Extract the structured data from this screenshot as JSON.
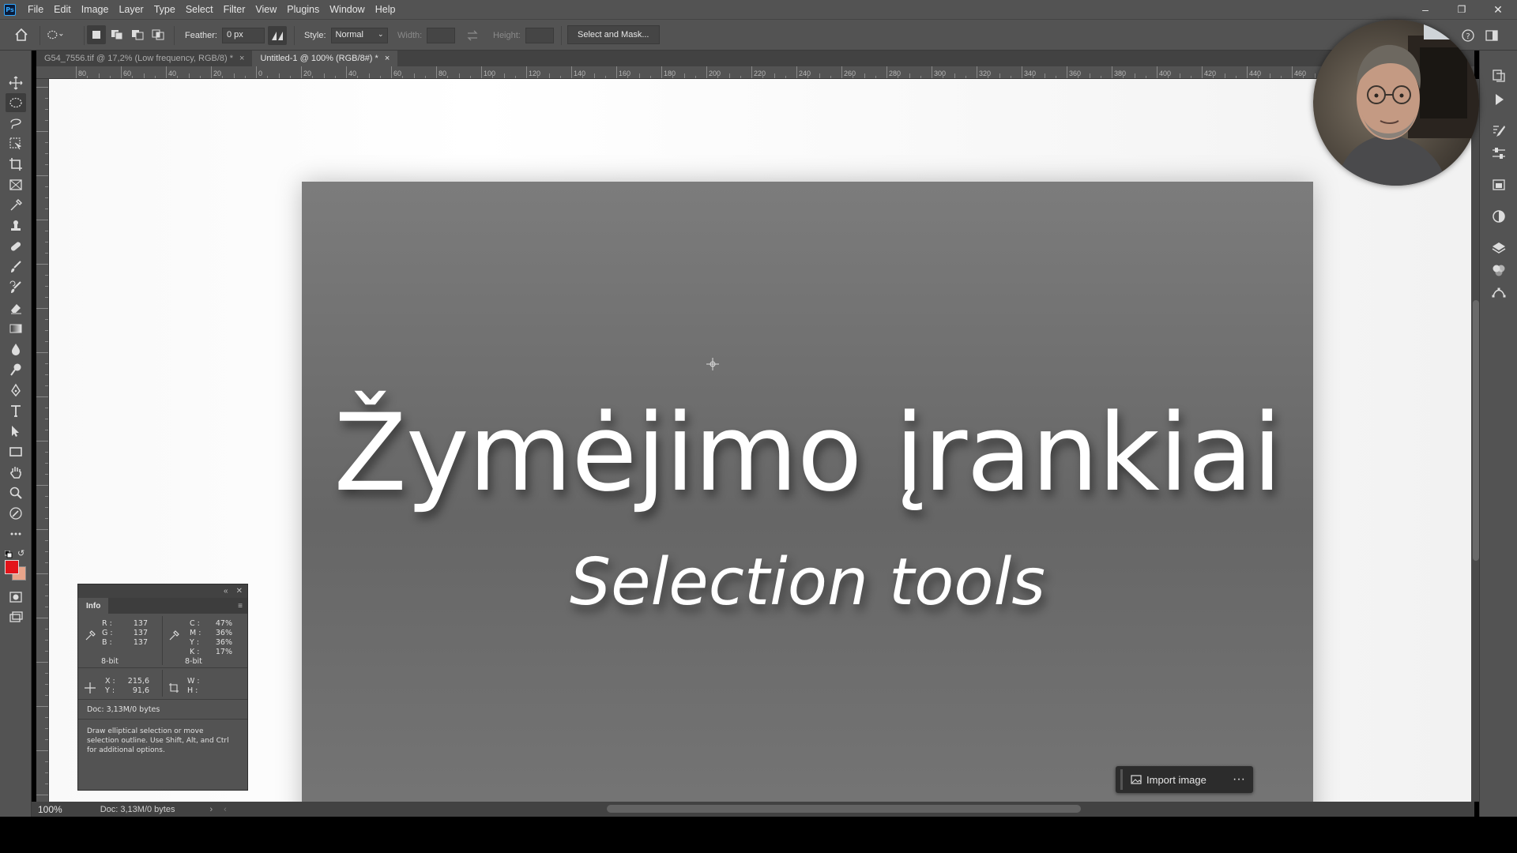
{
  "app": {
    "logo": "Ps"
  },
  "menu": [
    "File",
    "Edit",
    "Image",
    "Layer",
    "Type",
    "Select",
    "Filter",
    "View",
    "Plugins",
    "Window",
    "Help"
  ],
  "window_controls": {
    "minimize": "–",
    "restore": "❐",
    "close": "✕"
  },
  "options": {
    "feather_label": "Feather:",
    "feather_value": "0 px",
    "style_label": "Style:",
    "style_value": "Normal",
    "width_label": "Width:",
    "height_label": "Height:",
    "select_mask": "Select and Mask..."
  },
  "tabs": [
    {
      "label": "G54_7556.tif @ 17,2% (Low frequency, RGB/8) *",
      "close": "×"
    },
    {
      "label": "Untitled-1 @ 100% (RGB/8#) *",
      "close": "×"
    }
  ],
  "ruler_top": [
    "80",
    "60",
    "40",
    "20",
    "0",
    "20",
    "40",
    "60",
    "80",
    "100",
    "120",
    "140",
    "160",
    "180",
    "200",
    "220",
    "240",
    "260",
    "280",
    "300",
    "320",
    "340",
    "360",
    "380",
    "400",
    "420",
    "440",
    "460"
  ],
  "canvas": {
    "title": "Žymėjimo įrankiai",
    "subtitle": "Selection tools"
  },
  "import": {
    "label": "Import image",
    "more": "···"
  },
  "info_panel": {
    "tab": "Info",
    "rgb": {
      "r_label": "R :",
      "g_label": "G :",
      "b_label": "B :",
      "r": "137",
      "g": "137",
      "b": "137",
      "bit": "8-bit"
    },
    "cmyk": {
      "c_label": "C :",
      "m_label": "M :",
      "y_label": "Y :",
      "k_label": "K :",
      "c": "47%",
      "m": "36%",
      "y": "36%",
      "k": "17%",
      "bit": "8-bit"
    },
    "xy": {
      "x_label": "X :",
      "y_label": "Y :",
      "x": "215,6",
      "y": "91,6"
    },
    "wh": {
      "w_label": "W :",
      "h_label": "H :"
    },
    "doc": "Doc: 3,13M/0 bytes",
    "hint": "Draw elliptical selection or move selection outline.  Use Shift, Alt, and Ctrl for additional options."
  },
  "status": {
    "zoom": "100%",
    "doc": "Doc: 3,13M/0 bytes"
  }
}
